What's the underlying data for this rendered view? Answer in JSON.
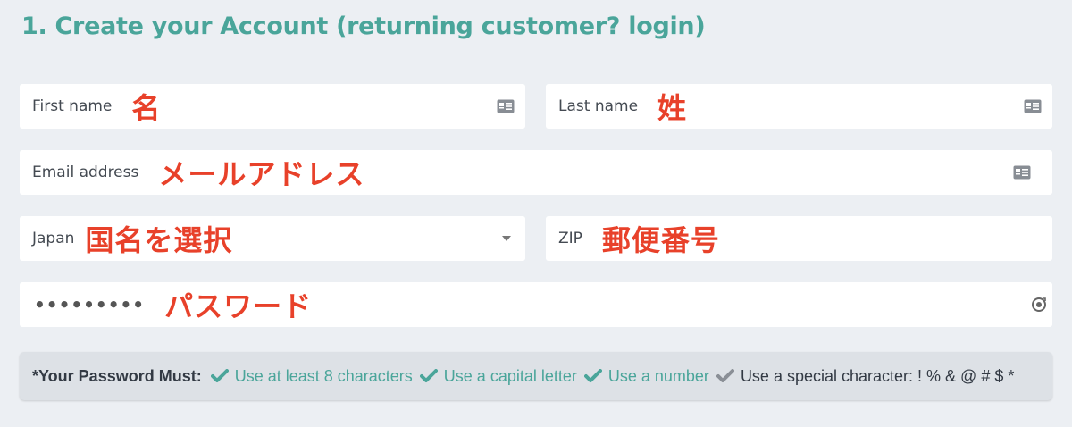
{
  "heading": {
    "prefix": "1. Create your Account (returning customer? ",
    "link": "login",
    "suffix": ")"
  },
  "fields": {
    "first_name": {
      "placeholder": "First name",
      "annotation": "名"
    },
    "last_name": {
      "placeholder": "Last name",
      "annotation": "姓"
    },
    "email": {
      "placeholder": "Email address",
      "annotation": "メールアドレス"
    },
    "country": {
      "value": "Japan",
      "annotation": "国名を選択"
    },
    "zip": {
      "placeholder": "ZIP",
      "annotation": "郵便番号"
    },
    "password": {
      "value": "•••••••••",
      "annotation": "パスワード"
    }
  },
  "password_rules": {
    "title": "*Your Password Must:",
    "items": [
      {
        "text": "Use at least 8 characters",
        "met": true
      },
      {
        "text": "Use a capital letter",
        "met": true
      },
      {
        "text": "Use a number",
        "met": true
      },
      {
        "text": "Use a special character: ! % & @ # $ *",
        "met": false
      }
    ]
  },
  "colors": {
    "accent": "#4aa59a",
    "annotation_red": "#e8412a",
    "background": "#eceff3",
    "rules_background": "#dde1e6"
  },
  "icons": {
    "contact_card": "contact-card-icon",
    "dropdown": "caret-down-icon",
    "password_toggle": "password-toggle-icon",
    "check": "check-icon"
  }
}
